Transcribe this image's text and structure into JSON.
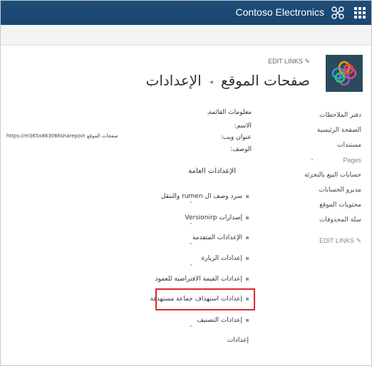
{
  "suite_bar": {
    "title": "Contoso Electronics",
    "logo_icon": "contoso-logo-icon",
    "waffle_icon": "app-launcher-icon"
  },
  "header": {
    "edit_links": "EDIT LINKS",
    "breadcrumb_site": "صفحات الموقع",
    "breadcrumb_page": "الإعدادات",
    "separator_icon": "chevron-icon"
  },
  "left_nav": {
    "items": [
      {
        "label": "دفتر الملاحظات"
      },
      {
        "label": "الصفحة الرئيسية"
      },
      {
        "label": "مستندات"
      },
      {
        "label": "Pages"
      },
      {
        "label": "حسابات البيع بالتجزئة"
      },
      {
        "label": "مديرو الحسابات"
      },
      {
        "label": "محتويات الموقع"
      },
      {
        "label": "سلة المحذوفات"
      }
    ],
    "edit_links": "EDIT LINKS"
  },
  "list_info": {
    "title": "معلومات القائمة",
    "name_label": "الاسم:",
    "web_address_label": "عنوان ويب:",
    "web_address_value": "https://m365x863066sharepoin صفحات الموقع",
    "description_label": "الوصف:"
  },
  "general_settings": {
    "title": "الإعدادات العامة",
    "items": [
      {
        "label": "سرد وصف ال rumen والتنقل"
      },
      {
        "label": "إصدارات Versionirp"
      },
      {
        "label": "الإعدادات المتقدمة"
      },
      {
        "label": "إعدادات الزيارة"
      },
      {
        "label": "إعدادات القيمة الافتراضية للعمود"
      },
      {
        "label": "إعدادات استهداف جماعة مستهدفة"
      },
      {
        "label": "إعدادات التصنيف"
      },
      {
        "label": "إعدادات"
      }
    ]
  },
  "colors": {
    "suite_bar": "#1e4d78",
    "highlight": "#e0282a",
    "site_logo_bg": "#2b4a5e"
  }
}
